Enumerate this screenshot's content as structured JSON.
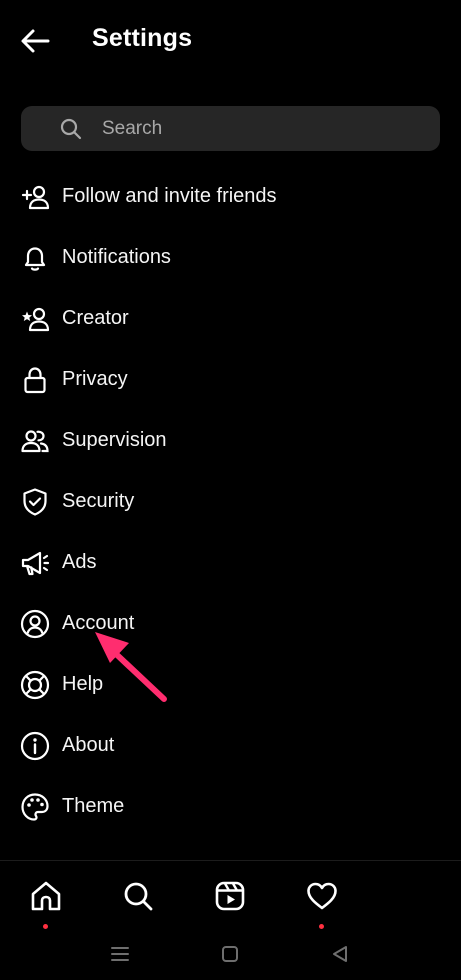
{
  "header": {
    "title": "Settings",
    "back_icon": "arrow-left-icon"
  },
  "search": {
    "placeholder": "Search",
    "icon": "search-icon"
  },
  "menu": {
    "items": [
      {
        "label": "Follow and invite friends",
        "icon": "add-person-icon"
      },
      {
        "label": "Notifications",
        "icon": "bell-icon"
      },
      {
        "label": "Creator",
        "icon": "creator-star-person-icon"
      },
      {
        "label": "Privacy",
        "icon": "lock-icon"
      },
      {
        "label": "Supervision",
        "icon": "people-icon"
      },
      {
        "label": "Security",
        "icon": "shield-check-icon"
      },
      {
        "label": "Ads",
        "icon": "megaphone-icon"
      },
      {
        "label": "Account",
        "icon": "account-circle-icon"
      },
      {
        "label": "Help",
        "icon": "lifebuoy-icon"
      },
      {
        "label": "About",
        "icon": "info-circle-icon"
      },
      {
        "label": "Theme",
        "icon": "palette-icon"
      }
    ]
  },
  "annotation": {
    "arrow_color": "#ff2d6f",
    "points_to": "Account"
  },
  "tabbar": {
    "tabs": [
      {
        "name": "home",
        "icon": "home-icon",
        "badge": true
      },
      {
        "name": "search",
        "icon": "search-icon",
        "badge": false
      },
      {
        "name": "reels",
        "icon": "reels-icon",
        "badge": false
      },
      {
        "name": "activity",
        "icon": "heart-icon",
        "badge": true
      }
    ],
    "badge_color": "#ff3040"
  },
  "system_nav": {
    "buttons": [
      "menu-icon",
      "home-square-icon",
      "back-triangle-icon"
    ]
  }
}
